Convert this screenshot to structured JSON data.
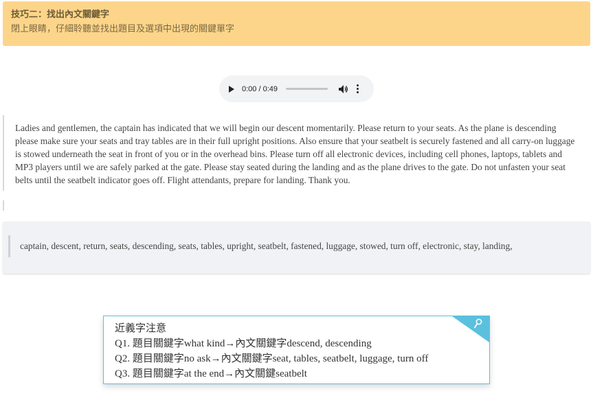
{
  "tip": {
    "title": "技巧二：找出內文關鍵字",
    "subtitle": "閉上眼睛，仔細聆聽並找出題目及選項中出現的關鍵單字"
  },
  "audio": {
    "time": "0:00 / 0:49",
    "progress": 0,
    "icons": [
      "play-icon",
      "volume-icon",
      "more-options-icon"
    ]
  },
  "transcript": "Ladies and gentlemen, the captain has indicated that we will begin our descent momentarily. Please return to your seats. As the plane is descending please make sure your seats and tray tables are in their full upright positions. Also ensure that your seatbelt is securely fastened and all carry-on luggage is stowed underneath the seat in front of you or in the overhead bins. Please turn off all electronic devices, including cell phones, laptops, tablets and MP3 players until we are safely parked at the gate. Please stay seated during the landing and as the plane drives to the gate. Do not unfasten your seat belts until the seatbelt indicator goes off. Flight attendants, prepare for landing. Thank you.",
  "keywords": "captain, descent, return, seats, descending, seats, tables, upright, seatbelt, fastened, luggage, stowed, turn off, electronic, stay, landing,",
  "note": {
    "title": "近義字注意",
    "lines": [
      "Q1. 題目關鍵字what kind→內文關鍵字descend, descending",
      "Q2. 題目關鍵字no ask→內文關鍵字seat, tables, seatbelt, luggage, turn off",
      "Q3. 題目關鍵字at the end→內文關鍵seatbelt"
    ],
    "corner_color": "#5bc0de",
    "icon": "pin-icon"
  },
  "colors": {
    "banner": "#fdd58a",
    "accent": "#5bc0de"
  }
}
